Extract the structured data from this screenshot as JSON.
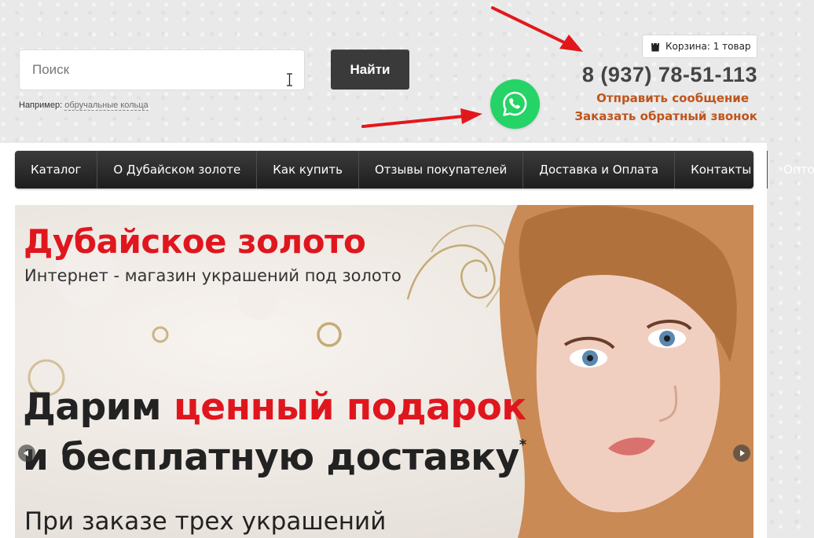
{
  "search": {
    "placeholder": "Поиск",
    "button_label": "Найти",
    "example_prefix": "Например:",
    "example_link": "обручальные кольца"
  },
  "header": {
    "cart_label": "Корзина: 1 товар",
    "phone": "8 (937) 78-51-113",
    "send_message": "Отправить сообщение",
    "callback": "Заказать обратный звонок",
    "whatsapp_icon": "whatsapp-icon"
  },
  "nav": {
    "items": [
      {
        "label": "Каталог"
      },
      {
        "label": "О Дубайском золоте"
      },
      {
        "label": "Как купить"
      },
      {
        "label": "Отзывы покупателей"
      },
      {
        "label": "Доставка и Оплата"
      },
      {
        "label": "Контакты"
      },
      {
        "label": "Оптом"
      }
    ]
  },
  "banner": {
    "title": "Дубайское золото",
    "subtitle": "Интернет - магазин украшений под золото",
    "line1_black": "Дарим ",
    "line1_red": "ценный подарок",
    "line2": "и бесплатную доставку",
    "line2_mark": "*",
    "line3": "При заказе трех украшений"
  },
  "colors": {
    "accent_red": "#e0161e",
    "link_orange": "#c0541b",
    "whatsapp_green": "#25d366",
    "nav_dark": "#2a2a2a"
  }
}
